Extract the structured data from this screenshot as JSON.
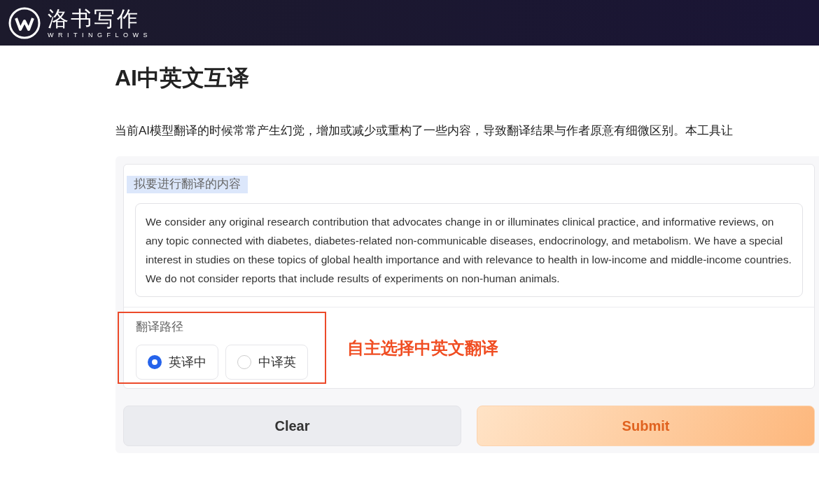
{
  "header": {
    "logo_text": "洛书写作",
    "logo_subtitle": "WRITINGFLOWS"
  },
  "title": "AI中英文互译",
  "description": "当前AI模型翻译的时候常常产生幻觉，增加或减少或重构了一些内容，导致翻译结果与作者原意有细微区别。本工具让",
  "input": {
    "label": "拟要进行翻译的内容",
    "value": "We consider any original research contribution that advocates change in or illuminates clinical practice, and informative reviews, on any topic connected with diabetes, diabetes-related non-communicable diseases, endocrinology, and metabolism. We have a special interest in studies on these topics of global health importance and with relevance to health in low-income and middle-income countries. We do not consider reports that include results of experiments on non-human animals."
  },
  "direction": {
    "label": "翻译路径",
    "options": [
      {
        "label": "英译中",
        "selected": true
      },
      {
        "label": "中译英",
        "selected": false
      }
    ]
  },
  "annotation": "自主选择中英文翻译",
  "buttons": [
    {
      "label": "Clear",
      "kind": "secondary"
    },
    {
      "label": "Submit",
      "kind": "primary"
    }
  ]
}
